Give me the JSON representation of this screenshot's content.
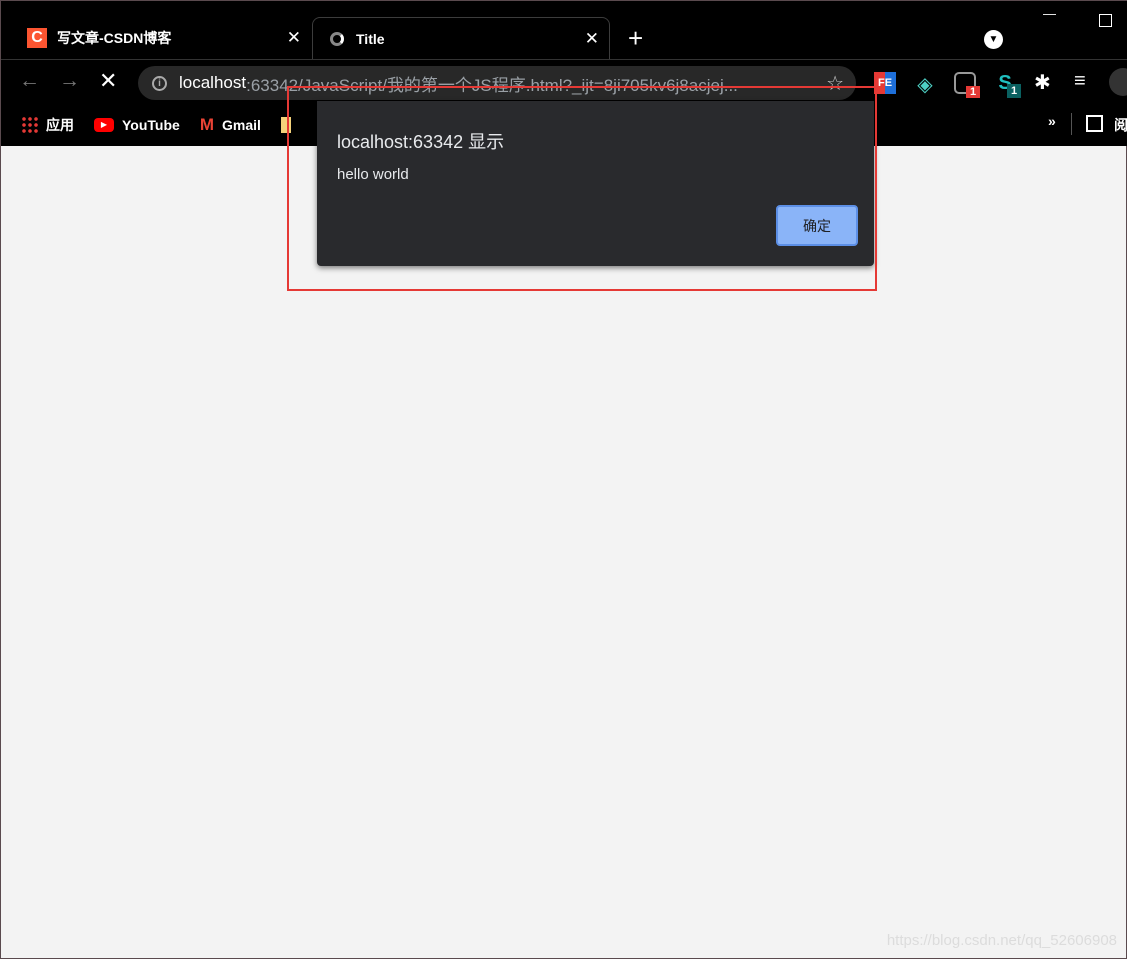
{
  "tabs": [
    {
      "title": "写文章-CSDN博客",
      "favicon": "csdn-icon"
    },
    {
      "title": "Title",
      "favicon": "loading-icon",
      "active": true
    }
  ],
  "window": {
    "new_tab": "+",
    "minimize": "—",
    "maximize": "☐"
  },
  "toolbar": {
    "url_host": "localhost",
    "url_rest": ":63342/JavaScript/我的第一个JS程序.html?_ijt=8ji705kv6j8acjej..."
  },
  "extensions": [
    {
      "label": "FE"
    },
    {
      "label": "◈"
    },
    {
      "label": "oo",
      "badge": "1"
    },
    {
      "label": "S",
      "badge": "1"
    }
  ],
  "bookmarks": [
    {
      "label": "应用",
      "icon": "apps-grid-icon"
    },
    {
      "label": "YouTube",
      "icon": "youtube-icon"
    },
    {
      "label": "Gmail",
      "icon": "gmail-icon"
    }
  ],
  "bookmarks_more": "»",
  "reading_list": "阅",
  "dialog": {
    "title": "localhost:63342 显示",
    "message": "hello world",
    "ok": "确定"
  },
  "watermark": "https://blog.csdn.net/qq_52606908",
  "colors": {
    "highlight": "#e53935",
    "ok_button": "#8ab4f8",
    "dialog_bg": "#292a2d",
    "page_bg": "#f3f3f3"
  }
}
